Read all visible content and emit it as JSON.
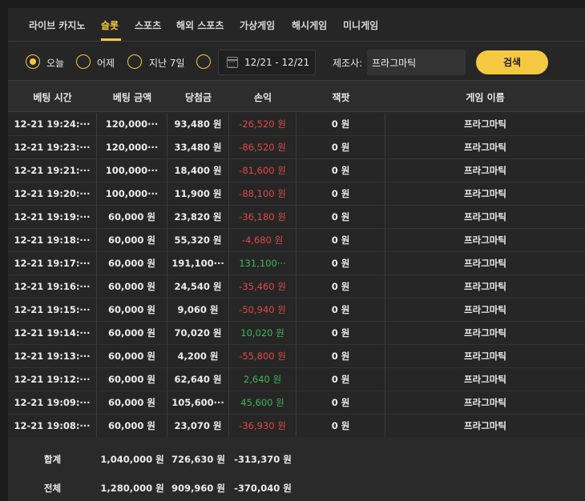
{
  "tabs": [
    {
      "label": "라이브 카지노",
      "active": false
    },
    {
      "label": "슬롯",
      "active": true
    },
    {
      "label": "스포츠",
      "active": false
    },
    {
      "label": "해외 스포츠",
      "active": false
    },
    {
      "label": "가상게임",
      "active": false
    },
    {
      "label": "해시게임",
      "active": false
    },
    {
      "label": "미니게임",
      "active": false
    }
  ],
  "filters": {
    "options": [
      {
        "label": "오늘",
        "checked": true
      },
      {
        "label": "어제",
        "checked": false
      },
      {
        "label": "지난 7일",
        "checked": false
      },
      {
        "label": "",
        "checked": false
      }
    ],
    "date_range": "12/21 - 12/21",
    "vendor_label": "제조사:",
    "vendor_value": "프라그마틱",
    "search_label": "검색"
  },
  "table": {
    "headers": [
      "베팅 시간",
      "베팅 금액",
      "당첨금",
      "손익",
      "잭팟",
      "게임 이름"
    ],
    "rows": [
      {
        "time": "12-21 19:24:···",
        "bet": "120,000···",
        "win": "93,480 원",
        "pl": "-26,520 원",
        "pl_sign": "neg",
        "jackpot": "0 원",
        "game": "프라그마틱"
      },
      {
        "time": "12-21 19:23:···",
        "bet": "120,000···",
        "win": "33,480 원",
        "pl": "-86,520 원",
        "pl_sign": "neg",
        "jackpot": "0 원",
        "game": "프라그마틱"
      },
      {
        "time": "12-21 19:21:···",
        "bet": "100,000···",
        "win": "18,400 원",
        "pl": "-81,600 원",
        "pl_sign": "neg",
        "jackpot": "0 원",
        "game": "프라그마틱"
      },
      {
        "time": "12-21 19:20:···",
        "bet": "100,000···",
        "win": "11,900 원",
        "pl": "-88,100 원",
        "pl_sign": "neg",
        "jackpot": "0 원",
        "game": "프라그마틱"
      },
      {
        "time": "12-21 19:19:···",
        "bet": "60,000 원",
        "win": "23,820 원",
        "pl": "-36,180 원",
        "pl_sign": "neg",
        "jackpot": "0 원",
        "game": "프라그마틱"
      },
      {
        "time": "12-21 19:18:···",
        "bet": "60,000 원",
        "win": "55,320 원",
        "pl": "-4,680 원",
        "pl_sign": "neg",
        "jackpot": "0 원",
        "game": "프라그마틱"
      },
      {
        "time": "12-21 19:17:···",
        "bet": "60,000 원",
        "win": "191,100···",
        "pl": "131,100···",
        "pl_sign": "pos",
        "jackpot": "0 원",
        "game": "프라그마틱"
      },
      {
        "time": "12-21 19:16:···",
        "bet": "60,000 원",
        "win": "24,540 원",
        "pl": "-35,460 원",
        "pl_sign": "neg",
        "jackpot": "0 원",
        "game": "프라그마틱"
      },
      {
        "time": "12-21 19:15:···",
        "bet": "60,000 원",
        "win": "9,060 원",
        "pl": "-50,940 원",
        "pl_sign": "neg",
        "jackpot": "0 원",
        "game": "프라그마틱"
      },
      {
        "time": "12-21 19:14:···",
        "bet": "60,000 원",
        "win": "70,020 원",
        "pl": "10,020 원",
        "pl_sign": "pos",
        "jackpot": "0 원",
        "game": "프라그마틱"
      },
      {
        "time": "12-21 19:13:···",
        "bet": "60,000 원",
        "win": "4,200 원",
        "pl": "-55,800 원",
        "pl_sign": "neg",
        "jackpot": "0 원",
        "game": "프라그마틱"
      },
      {
        "time": "12-21 19:12:···",
        "bet": "60,000 원",
        "win": "62,640 원",
        "pl": "2,640 원",
        "pl_sign": "pos",
        "jackpot": "0 원",
        "game": "프라그마틱"
      },
      {
        "time": "12-21 19:09:···",
        "bet": "60,000 원",
        "win": "105,600···",
        "pl": "45,600 원",
        "pl_sign": "pos",
        "jackpot": "0 원",
        "game": "프라그마틱"
      },
      {
        "time": "12-21 19:08:···",
        "bet": "60,000 원",
        "win": "23,070 원",
        "pl": "-36,930 원",
        "pl_sign": "neg",
        "jackpot": "0 원",
        "game": "프라그마틱"
      }
    ],
    "summary": [
      {
        "label": "합계",
        "bet": "1,040,000 원",
        "win": "726,630 원",
        "pl": "-313,370 원"
      },
      {
        "label": "전체",
        "bet": "1,280,000 원",
        "win": "909,960 원",
        "pl": "-370,040 원"
      }
    ]
  },
  "colors": {
    "accent": "#f5c842",
    "loss": "#e04848",
    "gain": "#3cb854",
    "background": "#262626"
  }
}
